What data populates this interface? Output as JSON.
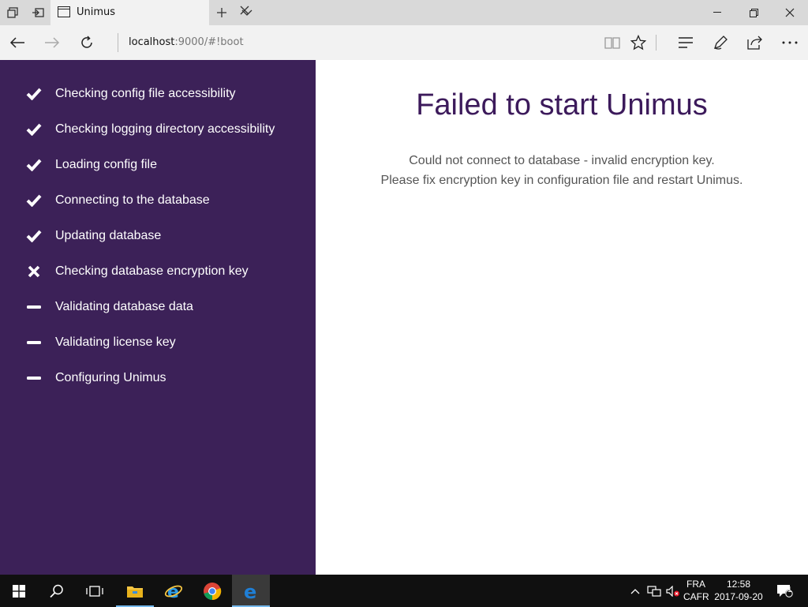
{
  "browser": {
    "tab_title": "Unimus",
    "url_host": "localhost",
    "url_rest": ":9000/#!boot"
  },
  "sidebar": {
    "steps": [
      {
        "label": "Checking config file accessibility",
        "status": "done",
        "icon": "check-icon"
      },
      {
        "label": "Checking logging directory accessibility",
        "status": "done",
        "icon": "check-icon"
      },
      {
        "label": "Loading config file",
        "status": "done",
        "icon": "check-icon"
      },
      {
        "label": "Connecting to the database",
        "status": "done",
        "icon": "check-icon"
      },
      {
        "label": "Updating database",
        "status": "done",
        "icon": "check-icon"
      },
      {
        "label": "Checking database encryption key",
        "status": "failed",
        "icon": "cross-icon"
      },
      {
        "label": "Validating database data",
        "status": "pending",
        "icon": "dash-icon"
      },
      {
        "label": "Validating license key",
        "status": "pending",
        "icon": "dash-icon"
      },
      {
        "label": "Configuring Unimus",
        "status": "pending",
        "icon": "dash-icon"
      }
    ]
  },
  "main": {
    "title": "Failed to start Unimus",
    "message_line1": "Could not connect to database - invalid encryption key.",
    "message_line2": "Please fix encryption key in configuration file and restart Unimus."
  },
  "taskbar": {
    "language_line1": "FRA",
    "language_line2": "CAFR",
    "time": "12:58",
    "date": "2017-09-20",
    "notification_count": "1"
  },
  "colors": {
    "sidebar_bg": "#3c2158",
    "title_color": "#3c1a5b",
    "accent_taskbar": "#76b9ed"
  }
}
